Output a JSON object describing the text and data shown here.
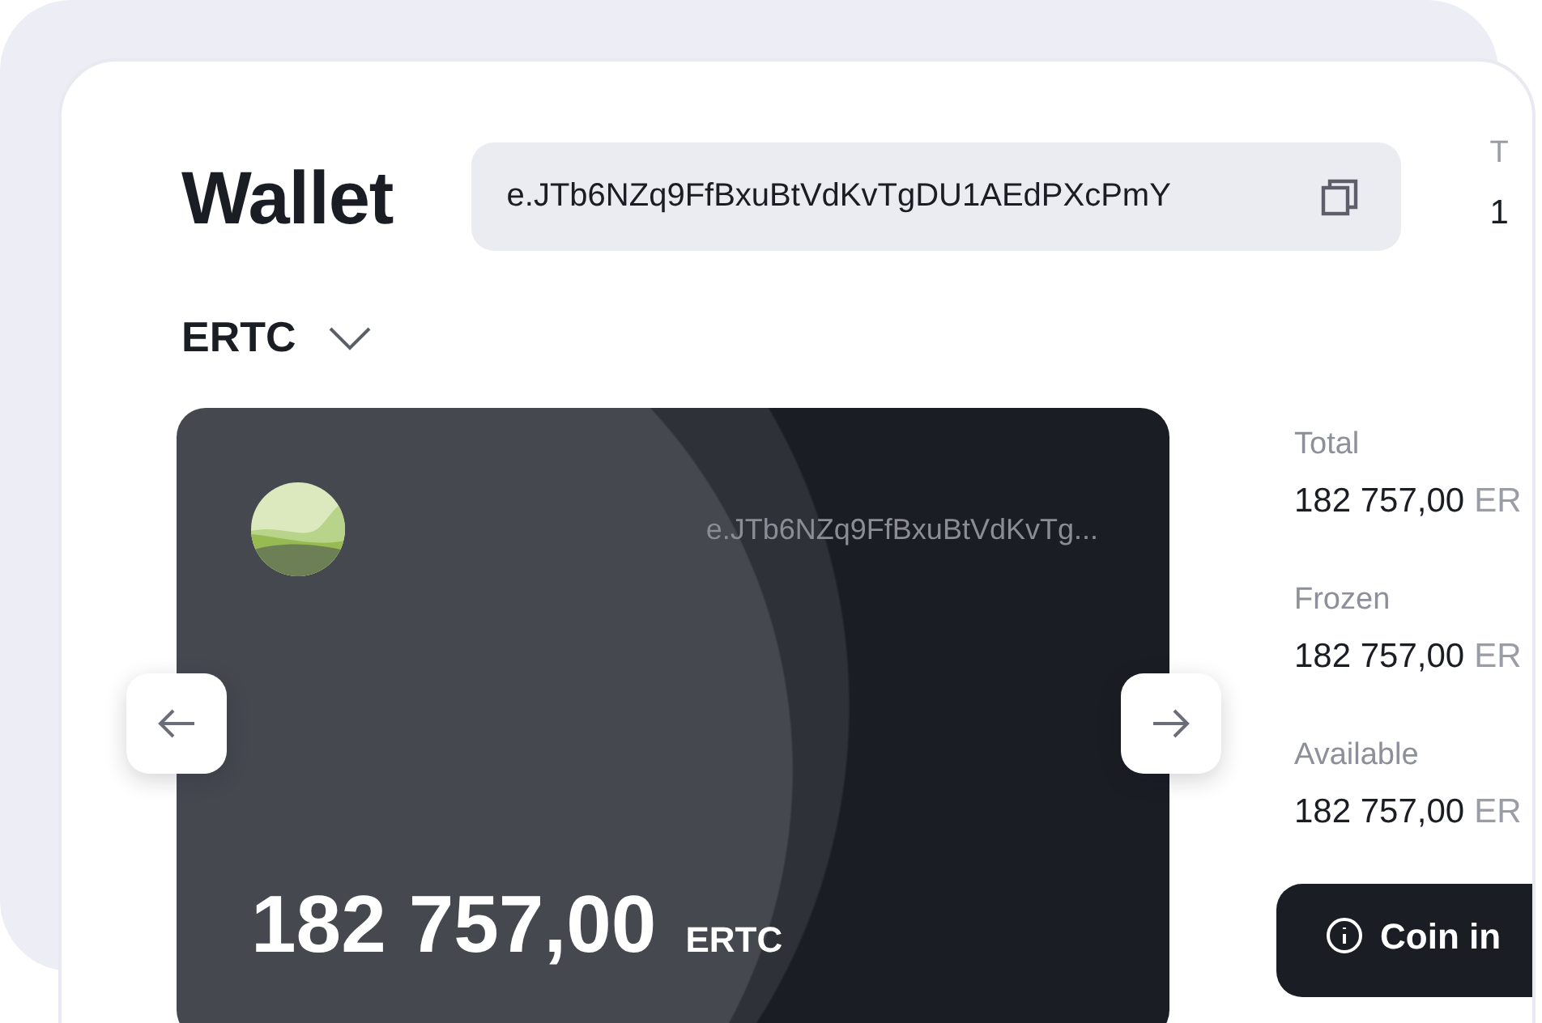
{
  "title": "Wallet",
  "address": {
    "value": "e.JTb6NZq9FfBxuBtVdKvTgDU1AEdPXcPmY"
  },
  "edge_column": {
    "label": "T",
    "value": "1"
  },
  "currency_select": {
    "value": "ERTC",
    "expanded": false
  },
  "card": {
    "address": "e.JTb6NZq9FfBxuBtVdKvTg...",
    "balance": "182 757,00",
    "currency": "ERTC"
  },
  "balances": [
    {
      "label": "Total",
      "value": "182 757,00",
      "currency": "ER"
    },
    {
      "label": "Frozen",
      "value": "182 757,00",
      "currency": "ER"
    },
    {
      "label": "Available",
      "value": "182 757,00",
      "currency": "ER"
    }
  ],
  "coin_info_button": {
    "label": "Coin in"
  }
}
